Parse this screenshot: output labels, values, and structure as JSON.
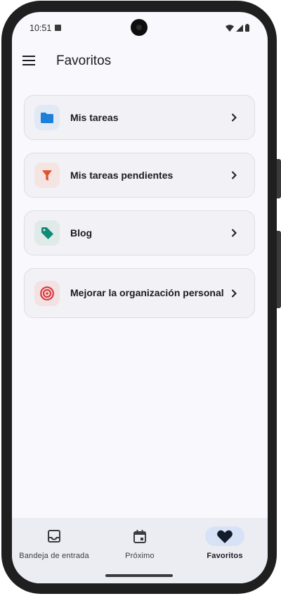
{
  "status_bar": {
    "time": "10:51"
  },
  "app_bar": {
    "title": "Favoritos"
  },
  "favorites": [
    {
      "label": "Mis tareas",
      "icon": "folder-icon",
      "icon_color": "#1e7fd9",
      "tile_color": "#e1e9f5"
    },
    {
      "label": "Mis tareas pendientes",
      "icon": "filter-icon",
      "icon_color": "#e0532f",
      "tile_color": "#f4e4e2"
    },
    {
      "label": "Blog",
      "icon": "tag-icon",
      "icon_color": "#0f8a74",
      "tile_color": "#dfeae9"
    },
    {
      "label": "Mejorar la organización personal",
      "icon": "target-icon",
      "icon_color": "#d9383c",
      "tile_color": "#f3e2e4"
    }
  ],
  "bottom_nav": [
    {
      "label": "Bandeja de entrada",
      "icon": "inbox-icon",
      "active": false
    },
    {
      "label": "Próximo",
      "icon": "calendar-icon",
      "active": false
    },
    {
      "label": "Favoritos",
      "icon": "heart-icon",
      "active": true
    }
  ],
  "colors": {
    "screen_bg": "#f9f8fc",
    "card_bg": "#f1f1f6",
    "nav_bg": "#ecedf3",
    "nav_active_pill": "#d8e2f6"
  }
}
